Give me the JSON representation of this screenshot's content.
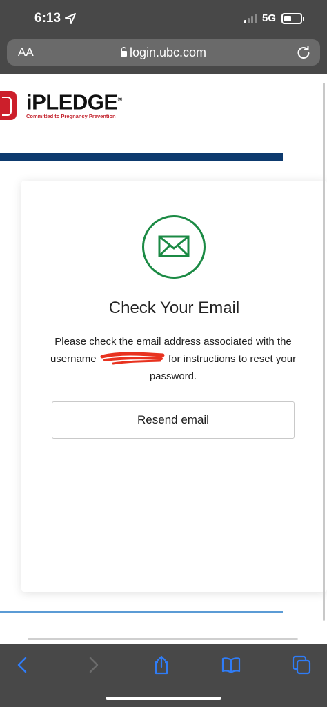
{
  "status_bar": {
    "time": "6:13",
    "network": "5G"
  },
  "address_bar": {
    "text_size_label": "AA",
    "url": "login.ubc.com"
  },
  "logo": {
    "brand": "iPLEDGE",
    "registered": "®",
    "tagline": "Committed to Pregnancy Prevention"
  },
  "card": {
    "heading": "Check Your Email",
    "message_before": "Please check the email address associated with the username",
    "message_after": "for instructions to reset your password.",
    "resend_label": "Resend email"
  },
  "icons": {
    "mail": "envelope-icon",
    "back": "chevron-left-icon",
    "forward": "chevron-right-icon",
    "share": "share-icon",
    "bookmarks": "book-icon",
    "tabs": "tabs-icon"
  },
  "colors": {
    "accent_green": "#1b8a44",
    "bar_navy": "#0d3a6e",
    "bar_light": "#5b9bd5",
    "toolbar_blue": "#2f7cf6",
    "brand_red": "#cc1f2b"
  }
}
